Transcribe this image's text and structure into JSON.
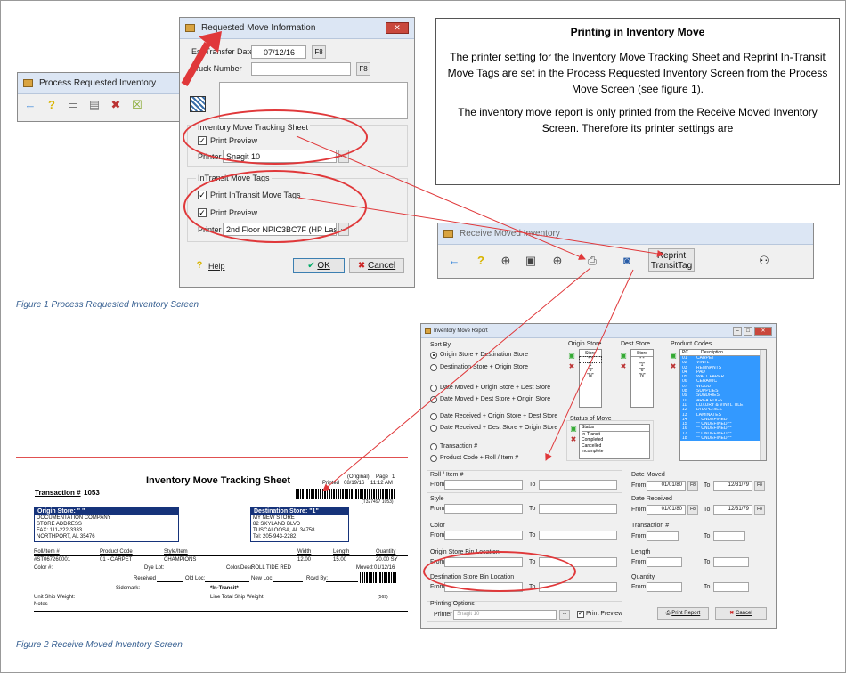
{
  "process_window": {
    "title": "Process Requested Inventory"
  },
  "move_dialog": {
    "title": "Requested Move Information",
    "est_transfer_label": "Est Transfer Date",
    "est_transfer_value": "07/12/16",
    "f8": "F8",
    "truck_label": "Truck Number",
    "tracking_group": "Inventory Move Tracking Sheet",
    "print_preview": "Print Preview",
    "printer_label": "Printer",
    "printer_value_1": "Snagit 10",
    "intransit_group": "InTransit Move Tags",
    "print_intransit": "Print InTransit Move Tags",
    "printer_value_2": "2nd Floor NPIC3BC7F (HP LaserJet",
    "ellipsis": "...",
    "help": "Help",
    "ok": "OK",
    "cancel": "Cancel"
  },
  "note": {
    "title": "Printing in Inventory Move",
    "p1": "The printer setting for the Inventory Move Tracking Sheet and Reprint In-Transit Move Tags are set in the Process Requested Inventory Screen from the Process Move Screen (see figure 1).",
    "p2": "The inventory move report is only printed from the Receive Moved Inventory Screen. Therefore its printer settings are"
  },
  "receive_window": {
    "title": "Receive Moved Inventory",
    "reprint_line1": "Reprint",
    "reprint_line2": "TransitTag"
  },
  "captions": {
    "fig1": "Figure 1 Process Requested Inventory Screen",
    "fig2": "Figure 2 Receive Moved Inventory Screen"
  },
  "report_dialog": {
    "title": "Inventory Move Report",
    "sort_by": "Sort By",
    "sort_options": [
      "Origin Store + Destination Store",
      "Destination Store + Origin Store",
      "Date Moved + Origin Store + Dest Store",
      "Date Moved + Dest Store + Origin Store",
      "Date Received + Origin Store + Dest Store",
      "Date Received + Dest Store + Origin Store",
      "Transaction #",
      "Product Code + Roll / Item #"
    ],
    "origin_store": "Origin Store",
    "dest_store": "Dest Store",
    "store_col": "Store",
    "store_values": [
      "\" \"",
      "\"1\"",
      "\"6\"",
      "\"N\""
    ],
    "product_codes": "Product Codes",
    "pc_col": "PC",
    "desc_col": "Description",
    "product_rows": [
      [
        "01",
        "CARPET"
      ],
      [
        "02",
        "VINYL"
      ],
      [
        "03",
        "REMNANTS"
      ],
      [
        "04",
        "PAD"
      ],
      [
        "05",
        "WALL PAPER"
      ],
      [
        "06",
        "CERAMIC"
      ],
      [
        "07",
        "WOOD"
      ],
      [
        "08",
        "SUPPLIES"
      ],
      [
        "09",
        "SUNDRIES"
      ],
      [
        "10",
        "AREA RUGS"
      ],
      [
        "11",
        "LUXURY & VINYL TILE"
      ],
      [
        "12",
        "DRAPERIES"
      ],
      [
        "13",
        "LAMINATES"
      ],
      [
        "14",
        "** UNDEFINED **"
      ],
      [
        "15",
        "** UNDEFINED **"
      ],
      [
        "16",
        "** UNDEFINED **"
      ],
      [
        "17",
        "** UNDEFINED **"
      ],
      [
        "18",
        "** UNDEFINED **"
      ]
    ],
    "status_of_move": "Status of Move",
    "status_col": "Status",
    "status_values": [
      "In-Transit",
      "Completed",
      "Cancelled",
      "Incomplete"
    ],
    "roll_item": "Roll / Item #",
    "style": "Style",
    "color": "Color",
    "origin_bin": "Origin Store Bin Location",
    "dest_bin": "Destination Store Bin Location",
    "from": "From",
    "to": "To",
    "date_moved": "Date Moved",
    "date_received": "Date Received",
    "date_from": "01/01/80",
    "date_to": "12/31/79",
    "transaction": "Transaction #",
    "length": "Length",
    "quantity": "Quantity",
    "printing_options": "Printing Options",
    "printer": "Printer",
    "printer_value": "Snagit 10",
    "print_preview": "Print Preview",
    "print_report": "Print Report",
    "cancel": "Cancel"
  },
  "report": {
    "title": "Inventory Move Tracking Sheet",
    "original": "(Original)",
    "page": "Page",
    "page_no": "1",
    "printed": "Printed",
    "printed_date": "08/19/16",
    "printed_time": "11:12 AM",
    "transaction_label": "Transaction #",
    "transaction_no": "1053",
    "barcode_text": "(T327497 1053)",
    "origin_label": "Origin Store: \" \"",
    "origin_lines": [
      "DOCUMENTATION COMPANY",
      "STORE ADDRESS",
      "FAX: 111-222-3333",
      "NORTHPORT, AL      35476"
    ],
    "dest_label": "Destination Store: \"1\"",
    "dest_lines": [
      "MY NEW STORE",
      "82 SKYLAND BLVD",
      "TUSCALOOSA, AL      34758",
      "Tel: 205-943-2282"
    ],
    "cols": [
      "Roll/Item #",
      "Product Code",
      "Style/Item",
      "Width",
      "Length",
      "Quantity"
    ],
    "row": [
      "#ST067260001",
      "01 - CARPET",
      "CHAMPIONS",
      "12.00",
      "15.00",
      "20.00 SY"
    ],
    "color": "Color #:",
    "dye_lot": "Dye Lot:",
    "color_desc": "Color/Desc",
    "color_desc_value": "ROLL TIDE RED",
    "moved": "Moved:",
    "moved_date": "01/12/16",
    "received": "Received",
    "old_loc": "Old Loc:",
    "new_loc": "New Loc:",
    "rcvd_by": "Rcvd By:",
    "sidemark": "Sidemark:",
    "in_transit": "*In-Transit*",
    "small_code": "(569)",
    "unit_ship": "Unit Ship Weight:",
    "line_total": "Line Total Ship Weight:",
    "notes": "Notes"
  },
  "colors": {
    "red": "#e0383a",
    "blue_select": "#3399ff",
    "caption": "#365f91"
  }
}
